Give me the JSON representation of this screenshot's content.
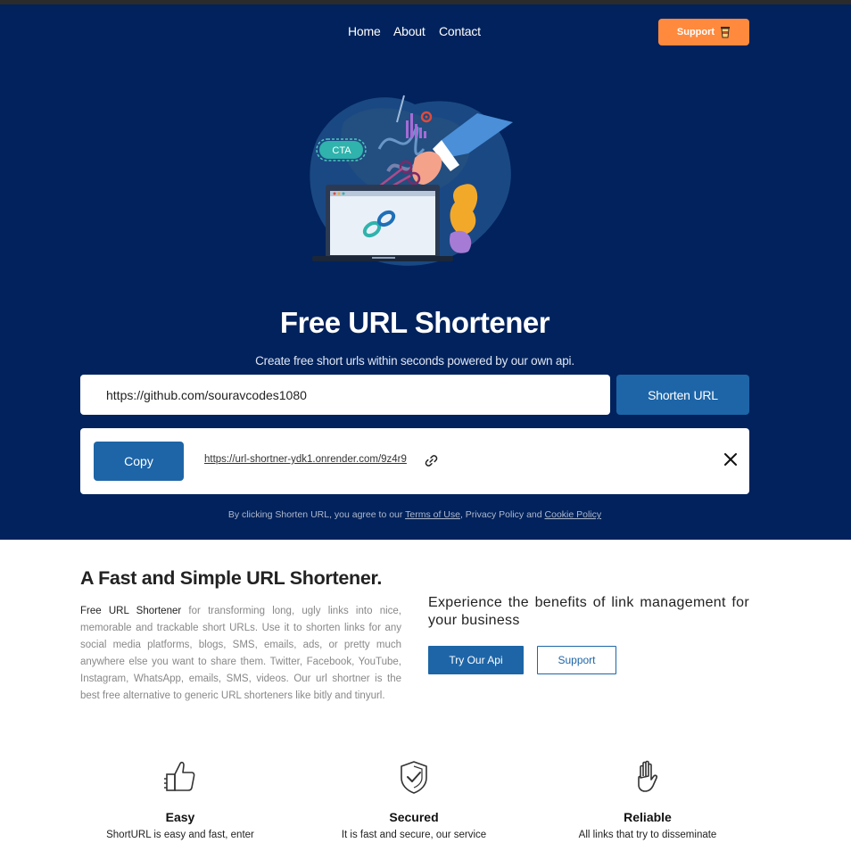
{
  "nav": {
    "links": [
      "Home",
      "About",
      "Contact"
    ],
    "support_label": "Support",
    "support_icon": "coffee-cup-icon"
  },
  "hero": {
    "illustration_badge": "CTA",
    "title": "Free URL Shortener",
    "subtitle": "Create free short urls within seconds powered by our own api.",
    "input_value": "https://github.com/souravcodes1080",
    "shorten_label": "Shorten URL",
    "copy_label": "Copy",
    "short_url": "https://url-shortner-ydk1.onrender.com/9z4r9",
    "terms": {
      "prefix": "By clicking Shorten URL, you agree to our ",
      "terms_link": "Terms of Use",
      "middle": ", Privacy Policy and ",
      "cookie_link": "Cookie Policy"
    }
  },
  "about": {
    "title": "A Fast and Simple URL Shortener.",
    "lead": "Free URL Shortener",
    "body": " for transforming long, ugly links into nice, memorable and trackable short URLs. Use it to shorten links for any social media platforms, blogs, SMS, emails, ads, or pretty much anywhere else you want to share them. Twitter, Facebook, YouTube, Instagram, WhatsApp, emails, SMS, videos. Our url shortner is the best free alternative to generic URL shorteners like bitly and tinyurl.",
    "benefits": "Experience the benefits of link management for your business",
    "try_api_label": "Try Our Api",
    "support_label": "Support"
  },
  "features": [
    {
      "icon": "thumbs-up-icon",
      "title": "Easy",
      "desc": "ShortURL is easy and fast, enter"
    },
    {
      "icon": "shield-check-icon",
      "title": "Secured",
      "desc": "It is fast and secure, our service"
    },
    {
      "icon": "hand-icon",
      "title": "Reliable",
      "desc": "All links that try to disseminate"
    }
  ],
  "colors": {
    "hero_bg": "#01225c",
    "accent_blue": "#1d65a7",
    "support_orange": "#ff8a3d"
  }
}
